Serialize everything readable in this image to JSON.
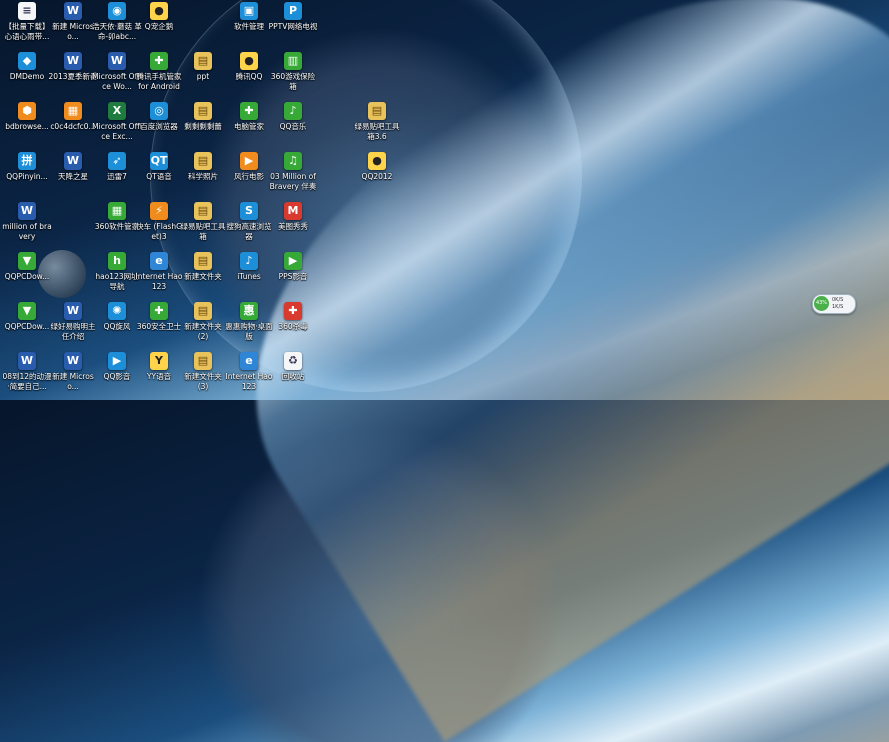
{
  "desktop": {
    "icons": [
      {
        "label": "【批量下载】心语心雨带...",
        "icon": "document-icon",
        "style": "g-doc",
        "glyph": "≡"
      },
      {
        "label": "新建 Microso...",
        "icon": "word-document-icon",
        "style": "g-word",
        "glyph": "W"
      },
      {
        "label": "浩天依·蘑菇 革命-卯abc...",
        "icon": "screenshot-tool-icon",
        "style": "g-app",
        "glyph": "◉"
      },
      {
        "label": "Q宠企鹅",
        "icon": "penguin-icon",
        "style": "g-qq",
        "glyph": "●"
      },
      {
        "label": "软件管理",
        "icon": "software-manager-icon",
        "style": "g-app",
        "glyph": "▣"
      },
      {
        "label": "PPTV网络电视",
        "icon": "pptv-icon",
        "style": "g-app",
        "glyph": "P"
      },
      {
        "label": "DMDemo",
        "icon": "dm-demo-icon",
        "style": "g-app",
        "glyph": "◆"
      },
      {
        "label": "2013夏季新番",
        "icon": "word-document-icon",
        "style": "g-word",
        "glyph": "W"
      },
      {
        "label": "Microsoft Office Wo...",
        "icon": "word-document-icon",
        "style": "g-word",
        "glyph": "W"
      },
      {
        "label": "腾讯手机管家 for Android",
        "icon": "phone-manager-icon",
        "style": "g-green",
        "glyph": "✚"
      },
      {
        "label": "ppt",
        "icon": "folder-icon",
        "style": "g-folder",
        "glyph": "▤"
      },
      {
        "label": "腾讯QQ",
        "icon": "qq-penguin-icon",
        "style": "g-qq",
        "glyph": "●"
      },
      {
        "label": "360游戏保险箱",
        "icon": "game-safe-icon",
        "style": "g-green",
        "glyph": "▥"
      },
      {
        "label": "bdbrowse...",
        "icon": "baidu-browser-installer-icon",
        "style": "g-orange",
        "glyph": "⬢"
      },
      {
        "label": "c0c4dcfc0...",
        "icon": "image-file-icon",
        "style": "g-orange",
        "glyph": "▦"
      },
      {
        "label": "Microsoft Office Exc...",
        "icon": "excel-icon",
        "style": "g-excel",
        "glyph": "X"
      },
      {
        "label": "百度浏览器",
        "icon": "baidu-browser-icon",
        "style": "g-app",
        "glyph": "◎"
      },
      {
        "label": "剩剩剩剩蕾",
        "icon": "folder-icon",
        "style": "g-folder",
        "glyph": "▤"
      },
      {
        "label": "电脑管家",
        "icon": "pc-manager-icon",
        "style": "g-green",
        "glyph": "✚"
      },
      {
        "label": "QQ音乐",
        "icon": "qq-music-icon",
        "style": "g-green",
        "glyph": "♪"
      },
      {
        "label": "绿易贴吧工具箱3.6",
        "icon": "toolbox-icon",
        "style": "g-folder",
        "glyph": "▤"
      },
      {
        "label": "QQPinyin...",
        "icon": "qq-pinyin-icon",
        "style": "g-app",
        "glyph": "拼"
      },
      {
        "label": "天降之星",
        "icon": "word-document-icon",
        "style": "g-word",
        "glyph": "W"
      },
      {
        "label": "迅雷7",
        "icon": "thunder-icon",
        "style": "g-app",
        "glyph": "➶"
      },
      {
        "label": "QT语音",
        "icon": "qt-voice-icon",
        "style": "g-app",
        "glyph": "QT"
      },
      {
        "label": "科学照片",
        "icon": "folder-icon",
        "style": "g-folder",
        "glyph": "▤"
      },
      {
        "label": "风行电影",
        "icon": "funshion-icon",
        "style": "g-orange",
        "glyph": "▶"
      },
      {
        "label": "03 Million of Bravery 伴奏",
        "icon": "audio-file-icon",
        "style": "g-green",
        "glyph": "♫"
      },
      {
        "label": "QQ2012",
        "icon": "qq-penguin-icon",
        "style": "g-qq",
        "glyph": "●"
      },
      {
        "label": "million of bravery",
        "icon": "word-document-icon",
        "style": "g-word",
        "glyph": "W"
      },
      {
        "label": "360软件管家",
        "icon": "software-manager-icon",
        "style": "g-green",
        "glyph": "▦"
      },
      {
        "label": "快车 (FlashGet)3",
        "icon": "flashget-icon",
        "style": "g-orange",
        "glyph": "⚡"
      },
      {
        "label": "绿易贴吧工具箱",
        "icon": "toolbox-icon",
        "style": "g-folder",
        "glyph": "▤"
      },
      {
        "label": "搜狗高速浏览器",
        "icon": "sogou-browser-icon",
        "style": "g-app",
        "glyph": "S"
      },
      {
        "label": "美图秀秀",
        "icon": "meitu-icon",
        "style": "g-red",
        "glyph": "M"
      },
      {
        "label": "QQPCDow...",
        "icon": "qq-pc-download-icon",
        "style": "g-green",
        "glyph": "▼"
      },
      {
        "label": "hao123网址导航",
        "icon": "hao123-icon",
        "style": "g-green",
        "glyph": "h"
      },
      {
        "label": "Internet Hao123",
        "icon": "ie-icon",
        "style": "g-ie",
        "glyph": "e"
      },
      {
        "label": "新建文件夹",
        "icon": "folder-icon",
        "style": "g-folder",
        "glyph": "▤"
      },
      {
        "label": "iTunes",
        "icon": "itunes-icon",
        "style": "g-app",
        "glyph": "♪"
      },
      {
        "label": "PPS影音",
        "icon": "pps-icon",
        "style": "g-green",
        "glyph": "▶"
      },
      {
        "label": "QQPCDow...",
        "icon": "qq-pc-download-icon",
        "style": "g-green",
        "glyph": "▼"
      },
      {
        "label": "绿好易购明主任介绍",
        "icon": "word-document-icon",
        "style": "g-word",
        "glyph": "W"
      },
      {
        "label": "QQ旋风",
        "icon": "qq-whirlwind-icon",
        "style": "g-app",
        "glyph": "✺"
      },
      {
        "label": "360安全卫士",
        "icon": "360-safe-icon",
        "style": "g-green",
        "glyph": "✚"
      },
      {
        "label": "新建文件夹 (2)",
        "icon": "folder-icon",
        "style": "g-folder",
        "glyph": "▤"
      },
      {
        "label": "惠惠购物·桌面版",
        "icon": "huihui-icon",
        "style": "g-green",
        "glyph": "惠"
      },
      {
        "label": "360杀毒",
        "icon": "360-antivirus-icon",
        "style": "g-red",
        "glyph": "✚"
      },
      {
        "label": "08到12的动漫·简要自己...",
        "icon": "word-document-icon",
        "style": "g-word",
        "glyph": "W"
      },
      {
        "label": "新建 Microso...",
        "icon": "word-document-icon",
        "style": "g-word",
        "glyph": "W"
      },
      {
        "label": "QQ影音",
        "icon": "qq-player-icon",
        "style": "g-app",
        "glyph": "▶"
      },
      {
        "label": "YY语音",
        "icon": "yy-voice-icon",
        "style": "g-qq",
        "glyph": "Y"
      },
      {
        "label": "新建文件夹 (3)",
        "icon": "folder-icon",
        "style": "g-folder",
        "glyph": "▤"
      },
      {
        "label": "Internet Hao123",
        "icon": "ie-icon",
        "style": "g-ie",
        "glyph": "e"
      },
      {
        "label": "回收站",
        "icon": "recycle-bin-icon",
        "style": "g-doc",
        "glyph": "♻"
      }
    ]
  },
  "network_widget": {
    "percent": "43%",
    "up": "0K/S",
    "down": "1K/S"
  }
}
